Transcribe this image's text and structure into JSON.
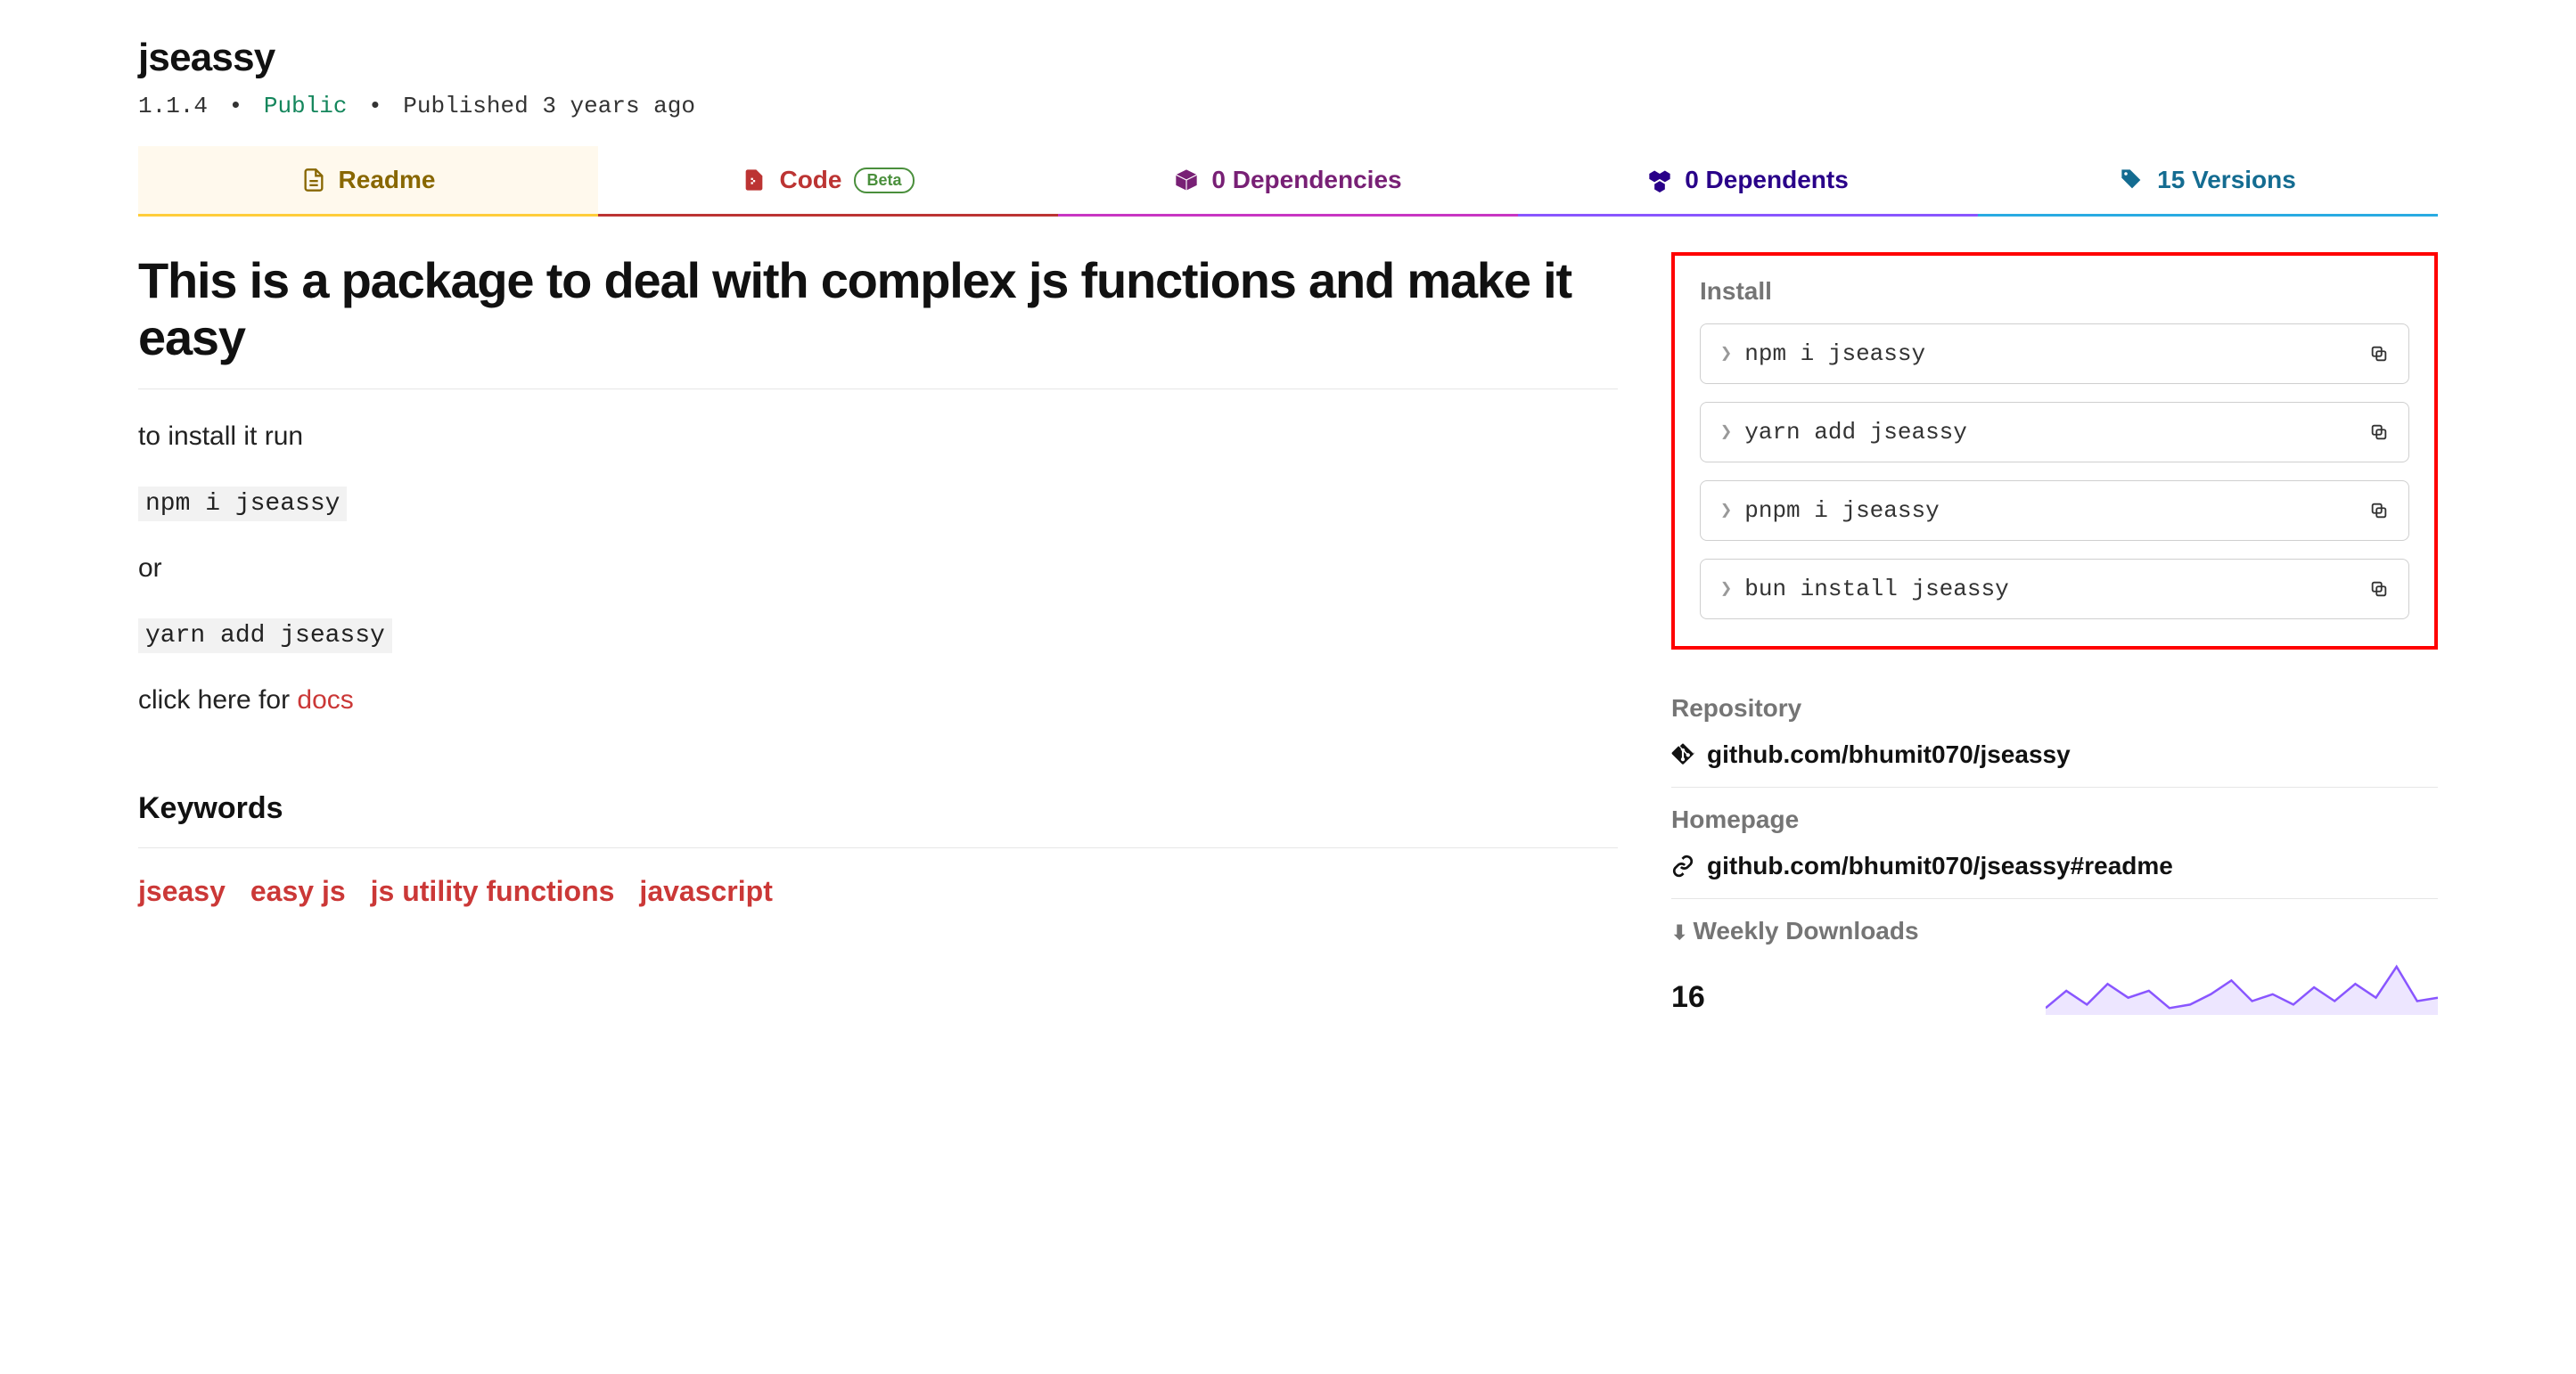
{
  "package": {
    "name": "jseassy",
    "version": "1.1.4",
    "visibility": "Public",
    "published": "Published 3 years ago"
  },
  "tabs": {
    "readme": "Readme",
    "code": "Code",
    "code_badge": "Beta",
    "dependencies": "0 Dependencies",
    "dependents": "0 Dependents",
    "versions": "15 Versions"
  },
  "readme": {
    "title": "This is a package to deal with complex js functions and make it easy",
    "install_text": "to install it run",
    "cmd1": "npm i jseassy",
    "or": "or",
    "cmd2": "yarn add jseassy",
    "docs_prefix": "click here for ",
    "docs_link": "docs"
  },
  "keywords_heading": "Keywords",
  "keywords": [
    "jseasy",
    "easy js",
    "js utility functions",
    "javascript"
  ],
  "sidebar": {
    "install_heading": "Install",
    "commands": [
      "npm i jseassy",
      "yarn add jseassy",
      "pnpm i jseassy",
      "bun install jseassy"
    ],
    "repository_heading": "Repository",
    "repository_url": "github.com/bhumit070/jseassy",
    "homepage_heading": "Homepage",
    "homepage_url": "github.com/bhumit070/jseassy#readme",
    "downloads_heading": "Weekly Downloads",
    "downloads_value": "16"
  },
  "chart_data": {
    "type": "area-sparkline",
    "description": "Weekly downloads trend",
    "values": [
      4,
      14,
      6,
      18,
      10,
      14,
      4,
      6,
      12,
      20,
      8,
      12,
      6,
      16,
      8,
      18,
      10,
      28,
      8,
      10
    ],
    "ylim": [
      0,
      30
    ]
  }
}
